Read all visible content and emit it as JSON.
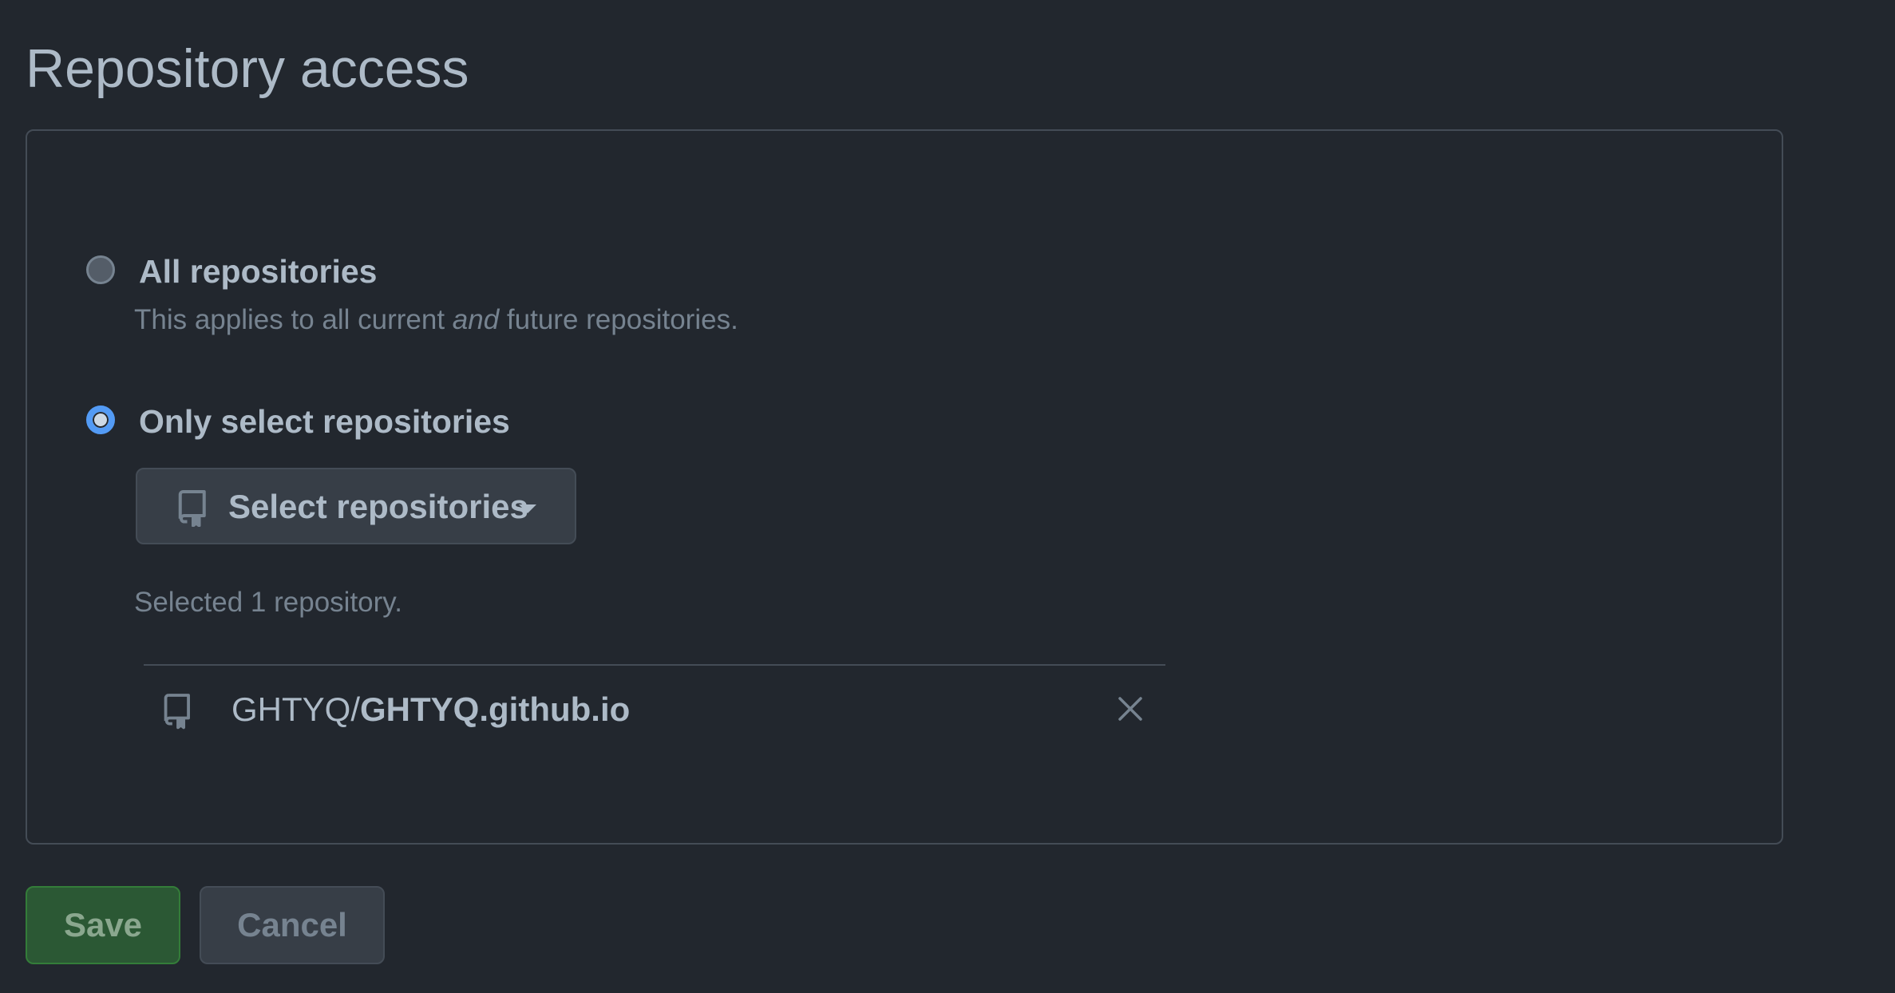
{
  "page": {
    "title": "Repository access"
  },
  "access": {
    "options": [
      {
        "label": "All repositories",
        "selected": false,
        "note_before": "This applies to all current ",
        "note_emphasis": "and",
        "note_after": " future repositories."
      },
      {
        "label": "Only select repositories",
        "selected": true
      }
    ],
    "select_button": {
      "label": "Select repositories",
      "icon": "repo-icon"
    },
    "selected_count_text": "Selected 1 repository.",
    "repositories": [
      {
        "owner": "GHTYQ/",
        "name": "GHTYQ.github.io",
        "icon": "repo-icon",
        "remove_icon": "close-icon"
      }
    ]
  },
  "actions": {
    "save_label": "Save",
    "cancel_label": "Cancel"
  },
  "colors": {
    "background": "#22272e",
    "accent": "#539bf5",
    "save": "#2b5834"
  }
}
